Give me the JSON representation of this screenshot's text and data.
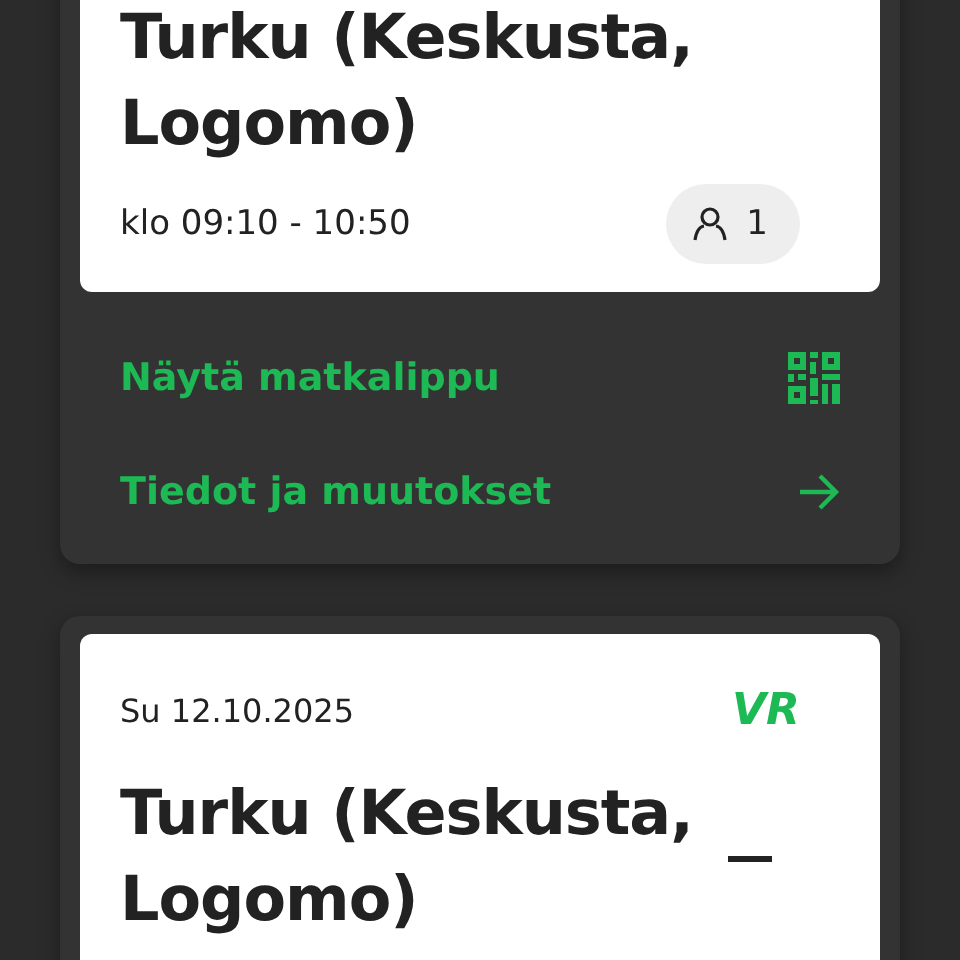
{
  "trips": [
    {
      "title": "Turku (Keskusta, Logomo)",
      "time": "klo 09:10 - 10:50",
      "passengers": "1",
      "actions": [
        {
          "label": "Näytä matkalippu",
          "kind": "qr"
        },
        {
          "label": "Tiedot ja muutokset",
          "kind": "arrow"
        }
      ]
    },
    {
      "date": "Su 12.10.2025",
      "title": "Turku (Keskusta, Logomo)",
      "logo": "VR"
    }
  ]
}
